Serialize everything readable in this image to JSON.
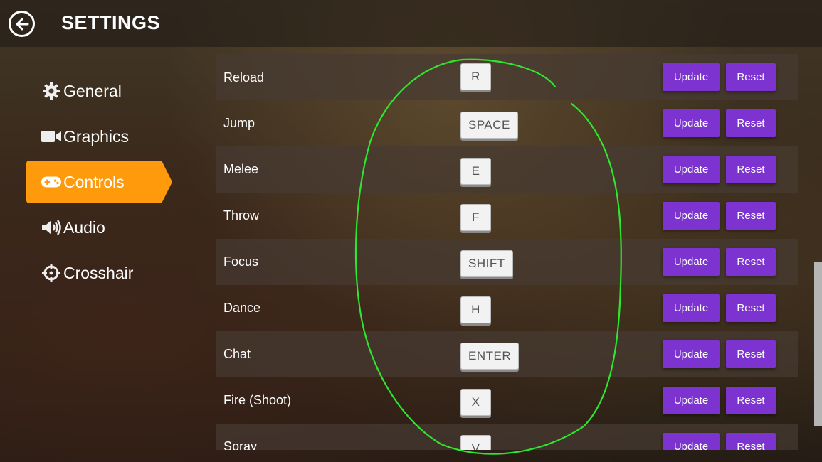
{
  "header": {
    "title": "SETTINGS",
    "back_icon": "arrow-left-circle-icon"
  },
  "sidebar": {
    "items": [
      {
        "label": "General",
        "icon": "gear-icon",
        "active": false
      },
      {
        "label": "Graphics",
        "icon": "video-camera-icon",
        "active": false
      },
      {
        "label": "Controls",
        "icon": "gamepad-icon",
        "active": true
      },
      {
        "label": "Audio",
        "icon": "speaker-icon",
        "active": false
      },
      {
        "label": "Crosshair",
        "icon": "crosshair-icon",
        "active": false
      }
    ],
    "active_color": "#ff9a0d"
  },
  "controls": {
    "update_label": "Update",
    "reset_label": "Reset",
    "button_color": "#7c33cf",
    "rows": [
      {
        "action": "Reload",
        "key": "R"
      },
      {
        "action": "Jump",
        "key": "SPACE"
      },
      {
        "action": "Melee",
        "key": "E"
      },
      {
        "action": "Throw",
        "key": "F"
      },
      {
        "action": "Focus",
        "key": "SHIFT"
      },
      {
        "action": "Dance",
        "key": "H"
      },
      {
        "action": "Chat",
        "key": "ENTER"
      },
      {
        "action": "Fire (Shoot)",
        "key": "X"
      },
      {
        "action": "Spray",
        "key": "V"
      }
    ]
  },
  "annotation": {
    "color": "#2ee62e"
  }
}
